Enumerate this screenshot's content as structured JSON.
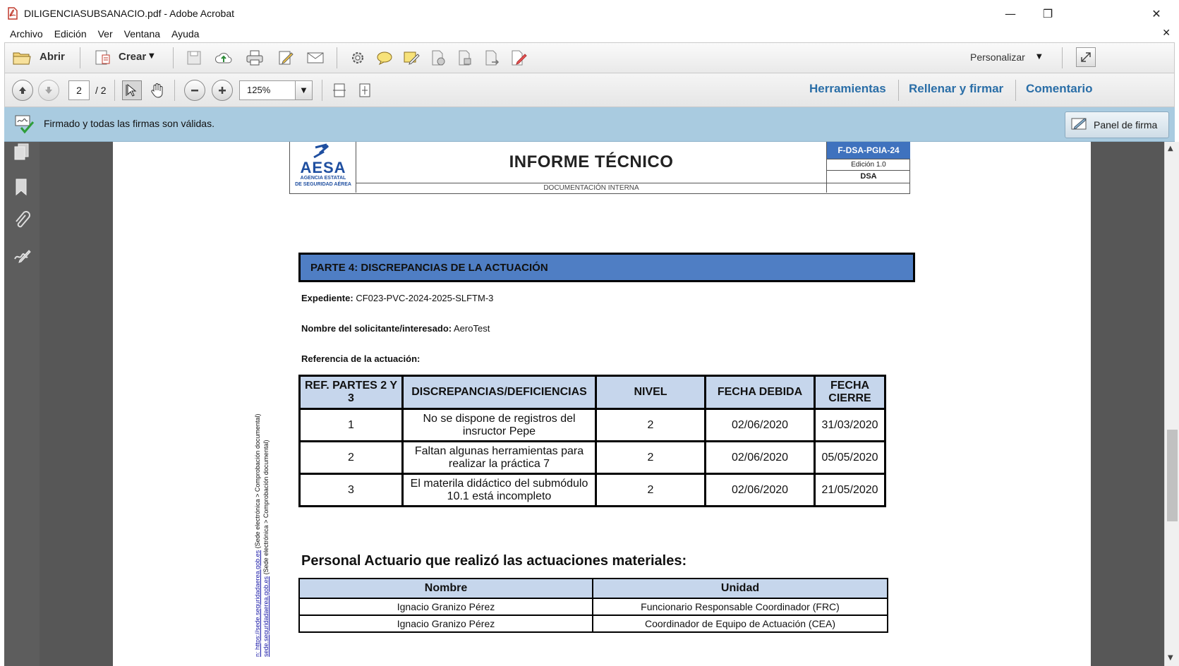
{
  "window": {
    "title": "DILIGENCIASUBSANACIO.pdf - Adobe Acrobat",
    "minimize": "—",
    "restore": "❐",
    "close": "✕"
  },
  "menu": {
    "items": [
      "Archivo",
      "Edición",
      "Ver",
      "Ventana",
      "Ayuda"
    ],
    "close_doc": "✕"
  },
  "toolbar": {
    "open_label": "Abrir",
    "create_label": "Crear",
    "customize_label": "Personalizar"
  },
  "navbar": {
    "current_page": "2",
    "total_pages": "/ 2",
    "zoom": "125%",
    "tools_label": "Herramientas",
    "fill_sign_label": "Rellenar y firmar",
    "comment_label": "Comentario"
  },
  "signature_bar": {
    "message": "Firmado y todas las firmas son válidas.",
    "panel_button": "Panel de firma"
  },
  "document": {
    "logo_text": "AESA",
    "logo_sub1": "AGENCIA ESTATAL",
    "logo_sub2": "DE SEGURIDAD AÉREA",
    "title": "INFORME TÉCNICO",
    "subtitle": "DOCUMENTACIÓN INTERNA",
    "code": "F-DSA-PGIA-24",
    "edition": "Edición 1.0",
    "dept": "DSA",
    "section_title": "PARTE 4: DISCREPANCIAS DE LA ACTUACIÓN",
    "expediente_label": "Expediente:",
    "expediente_value": "CF023-PVC-2024-2025-SLFTM-3",
    "solicitante_label": "Nombre del solicitante/interesado:",
    "solicitante_value": "AeroTest",
    "referencia_label": "Referencia de la actuación:",
    "discrepancies": {
      "headers": [
        "REF. PARTES 2 Y 3",
        "DISCREPANCIAS/DEFICIENCIAS",
        "NIVEL",
        "FECHA DEBIDA",
        "FECHA CIERRE"
      ],
      "rows": [
        [
          "1",
          "No se dispone de registros del insructor Pepe",
          "2",
          "02/06/2020",
          "31/03/2020"
        ],
        [
          "2",
          "Faltan algunas herramientas para realizar la práctica 7",
          "2",
          "02/06/2020",
          "05/05/2020"
        ],
        [
          "3",
          "El materila didáctico del submódulo 10.1 está incompleto",
          "2",
          "02/06/2020",
          "21/05/2020"
        ]
      ]
    },
    "personal_title": "Personal Actuario que realizó las actuaciones materiales:",
    "personal": {
      "headers": [
        "Nombre",
        "Unidad"
      ],
      "rows": [
        [
          "Ignacio Granizo Pérez",
          "Funcionario Responsable Coordinador (FRC)"
        ],
        [
          "Ignacio Granizo Pérez",
          "Coordinador de Equipo de Actuación (CEA)"
        ]
      ]
    },
    "vertical_line1_link": "n: https://sede.seguridadaerea.gob.es",
    "vertical_line1_rest": " (Sede electrónica > Comprobación documental)",
    "vertical_line2_link": "sede.seguridadaerea.gob.es",
    "vertical_line2_rest": " (Sede electrónica > Comprobación documental)"
  },
  "colors": {
    "section_bar": "#4f7ec4",
    "table_header": "#c6d6ec",
    "signature_bar": "#a9cbe0",
    "link_blue": "#2a6ea7"
  }
}
